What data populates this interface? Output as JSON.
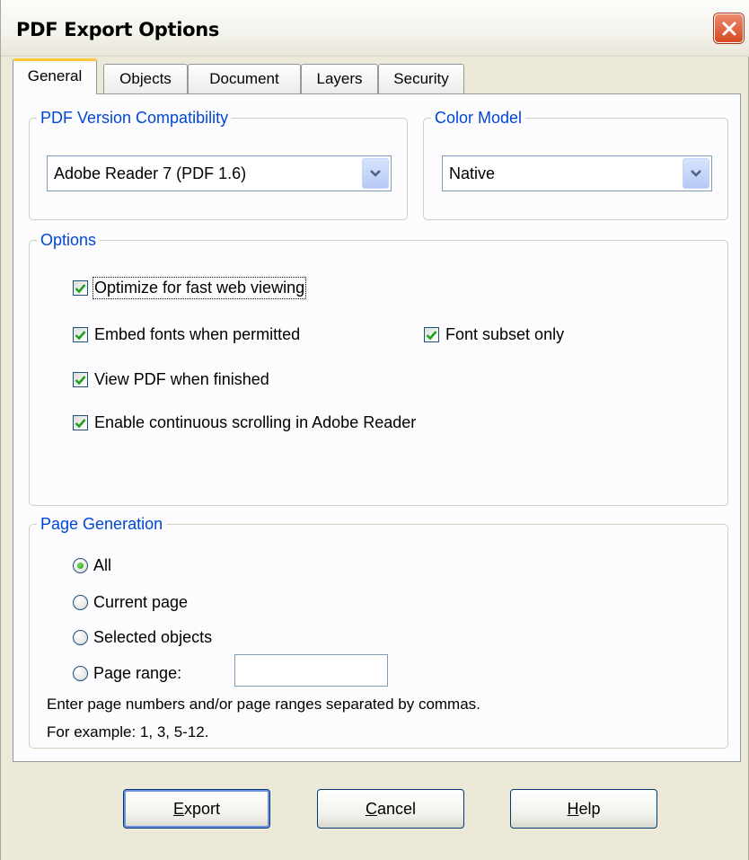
{
  "window": {
    "title": "PDF Export Options"
  },
  "tabs": [
    {
      "label": "General",
      "active": true
    },
    {
      "label": "Objects",
      "active": false
    },
    {
      "label": "Document",
      "active": false
    },
    {
      "label": "Layers",
      "active": false
    },
    {
      "label": "Security",
      "active": false
    }
  ],
  "pdf_version": {
    "legend": "PDF Version Compatibility",
    "selected": "Adobe Reader 7 (PDF 1.6)"
  },
  "color_model": {
    "legend": "Color Model",
    "selected": "Native"
  },
  "options": {
    "legend": "Options",
    "items": [
      {
        "label": "Optimize for fast web viewing",
        "checked": true
      },
      {
        "label": "Embed fonts when permitted",
        "checked": true
      },
      {
        "label": "Font subset only",
        "checked": true
      },
      {
        "label": "View PDF when finished",
        "checked": true
      },
      {
        "label": "Enable continuous scrolling in Adobe Reader",
        "checked": true
      }
    ]
  },
  "page_generation": {
    "legend": "Page Generation",
    "radios": [
      {
        "label": "All",
        "selected": true
      },
      {
        "label": "Current page",
        "selected": false
      },
      {
        "label": "Selected objects",
        "selected": false
      },
      {
        "label": "Page range:",
        "selected": false
      }
    ],
    "page_range_value": "",
    "hint_line1": "Enter page numbers and/or page ranges separated by commas.",
    "hint_line2": "For example: 1, 3, 5-12."
  },
  "buttons": {
    "export": {
      "accel": "E",
      "rest": "xport"
    },
    "cancel": {
      "accel": "C",
      "rest": "ancel"
    },
    "help": {
      "accel": "H",
      "rest": "elp"
    }
  },
  "colors": {
    "accent_blue": "#0046d5",
    "tab_highlight": "#ffc83c",
    "check_green": "#21a121",
    "close_red": "#d5491f"
  }
}
